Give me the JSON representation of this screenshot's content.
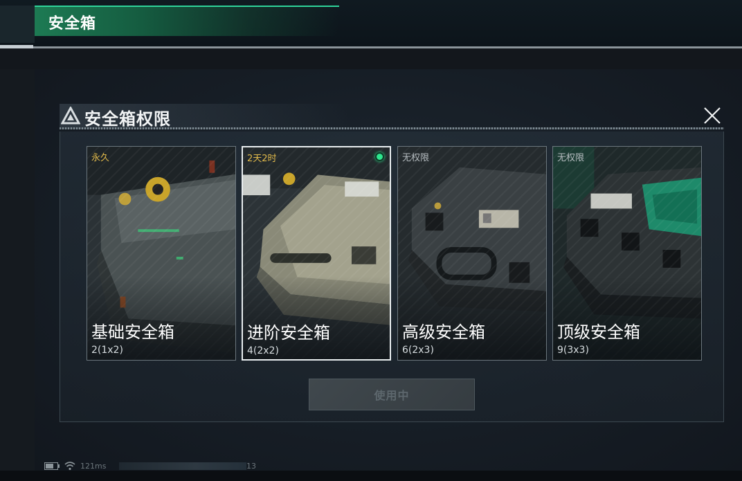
{
  "header": {
    "title": "安全箱"
  },
  "dialog": {
    "title": "安全箱权限",
    "icon": "warning-triangle-icon",
    "close_icon": "close-icon"
  },
  "cards": [
    {
      "badge": "永久",
      "badge_color": "#e0b94a",
      "name": "基础安全箱",
      "capacity": "2(1x2)",
      "selected": false,
      "active": false
    },
    {
      "badge": "2天2时",
      "badge_color": "#e0b94a",
      "name": "进阶安全箱",
      "capacity": "4(2x2)",
      "selected": true,
      "active": true
    },
    {
      "badge": "无权限",
      "badge_color": "#b7bec2",
      "name": "高级安全箱",
      "capacity": "6(2x3)",
      "selected": false,
      "active": false
    },
    {
      "badge": "无权限",
      "badge_color": "#b7bec2",
      "name": "顶级安全箱",
      "capacity": "9(3x3)",
      "selected": false,
      "active": false
    }
  ],
  "action_button": {
    "label": "使用中",
    "enabled": false
  },
  "status_bar": {
    "ping": "121ms",
    "number": "13"
  },
  "colors": {
    "accent_green": "#1d7a53",
    "active_dot": "#2ee68f"
  }
}
